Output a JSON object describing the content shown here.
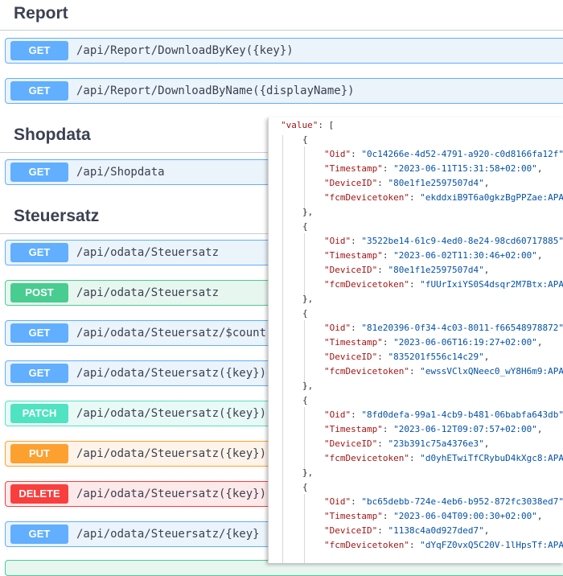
{
  "sections": {
    "report": {
      "title": "Report"
    },
    "shopdata": {
      "title": "Shopdata"
    },
    "steuersatz": {
      "title": "Steuersatz"
    }
  },
  "operations": [
    {
      "method": "GET",
      "path": "/api/Report/DownloadByKey({key})"
    },
    {
      "method": "GET",
      "path": "/api/Report/DownloadByName({displayName})"
    },
    {
      "method": "GET",
      "path": "/api/Shopdata"
    },
    {
      "method": "GET",
      "path": "/api/odata/Steuersatz"
    },
    {
      "method": "POST",
      "path": "/api/odata/Steuersatz"
    },
    {
      "method": "GET",
      "path": "/api/odata/Steuersatz/$count"
    },
    {
      "method": "GET",
      "path": "/api/odata/Steuersatz({key})"
    },
    {
      "method": "PATCH",
      "path": "/api/odata/Steuersatz({key})"
    },
    {
      "method": "PUT",
      "path": "/api/odata/Steuersatz({key})"
    },
    {
      "method": "DELETE",
      "path": "/api/odata/Steuersatz({key})"
    },
    {
      "method": "GET",
      "path": "/api/odata/Steuersatz/{key}"
    }
  ],
  "colors": {
    "get": "#61affe",
    "post": "#49cc90",
    "patch": "#50e3c2",
    "put": "#fca130",
    "delete": "#f93e3e",
    "json_key": "#a31515",
    "json_string": "#0451a5"
  },
  "json": {
    "root_key": "\"value\"",
    "root_open": ": [",
    "keys": {
      "oid": "\"Oid\"",
      "timestamp": "\"Timestamp\"",
      "device_id": "\"DeviceID\"",
      "fcm": "\"fcmDevicetoken\""
    },
    "items": [
      {
        "oid": "\"0c14266e-4d52-4791-a920-c0d8166fa12f\"",
        "timestamp": "\"2023-06-11T15:31:58+02:00\"",
        "device_id": "\"80e1f1e2597507d4\"",
        "fcm": "\"ekddxiB9T6a0gkzBgPPZae:APA"
      },
      {
        "oid": "\"3522be14-61c9-4ed0-8e24-98cd60717885\"",
        "timestamp": "\"2023-06-02T11:30:46+02:00\"",
        "device_id": "\"80e1f1e2597507d4\"",
        "fcm": "\"fUUrIxiYS0S4dsqr2M7Btx:APA"
      },
      {
        "oid": "\"81e20396-0f34-4c03-8011-f66548978872\"",
        "timestamp": "\"2023-06-06T16:19:27+02:00\"",
        "device_id": "\"835201f556c14c29\"",
        "fcm": "\"ewssVClxQNeec0_wY8H6m9:APA"
      },
      {
        "oid": "\"8fd0defa-99a1-4cb9-b481-06babfa643db\"",
        "timestamp": "\"2023-06-12T09:07:57+02:00\"",
        "device_id": "\"23b391c75a4376e3\"",
        "fcm": "\"d0yhETwiTfCRybuD4kXgc8:APA"
      },
      {
        "oid": "\"bc65debb-724e-4eb6-b952-872fc3038ed7\"",
        "timestamp": "\"2023-06-04T09:00:30+02:00\"",
        "device_id": "\"1138c4a0d927ded7\"",
        "fcm": "\"dYqFZ0vxQ5C20V-1lHpsTf:APA"
      }
    ]
  }
}
